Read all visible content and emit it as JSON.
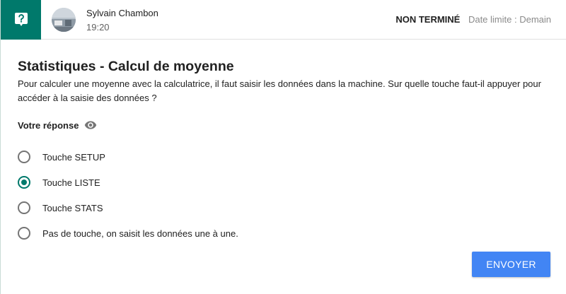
{
  "header": {
    "type_icon": "question-mark-icon",
    "author_name": "Sylvain Chambon",
    "post_time": "19:20",
    "status": "NON TERMINÉ",
    "deadline": "Date limite : Demain"
  },
  "assignment": {
    "title": "Statistiques - Calcul de moyenne",
    "question": "Pour calculer une moyenne avec la calculatrice, il faut saisir les données dans la machine. Sur quelle touche faut-il appuyer pour accéder à la saisie des données ?"
  },
  "answer": {
    "label": "Votre réponse",
    "visibility_icon": "eye-icon",
    "selected_index": 1,
    "options": [
      {
        "label": "Touche SETUP"
      },
      {
        "label": "Touche LISTE"
      },
      {
        "label": "Touche STATS"
      },
      {
        "label": "Pas de touche, on saisit les données une à une."
      }
    ],
    "submit_label": "ENVOYER"
  },
  "colors": {
    "accent": "#00796b",
    "button": "#4285f4"
  }
}
